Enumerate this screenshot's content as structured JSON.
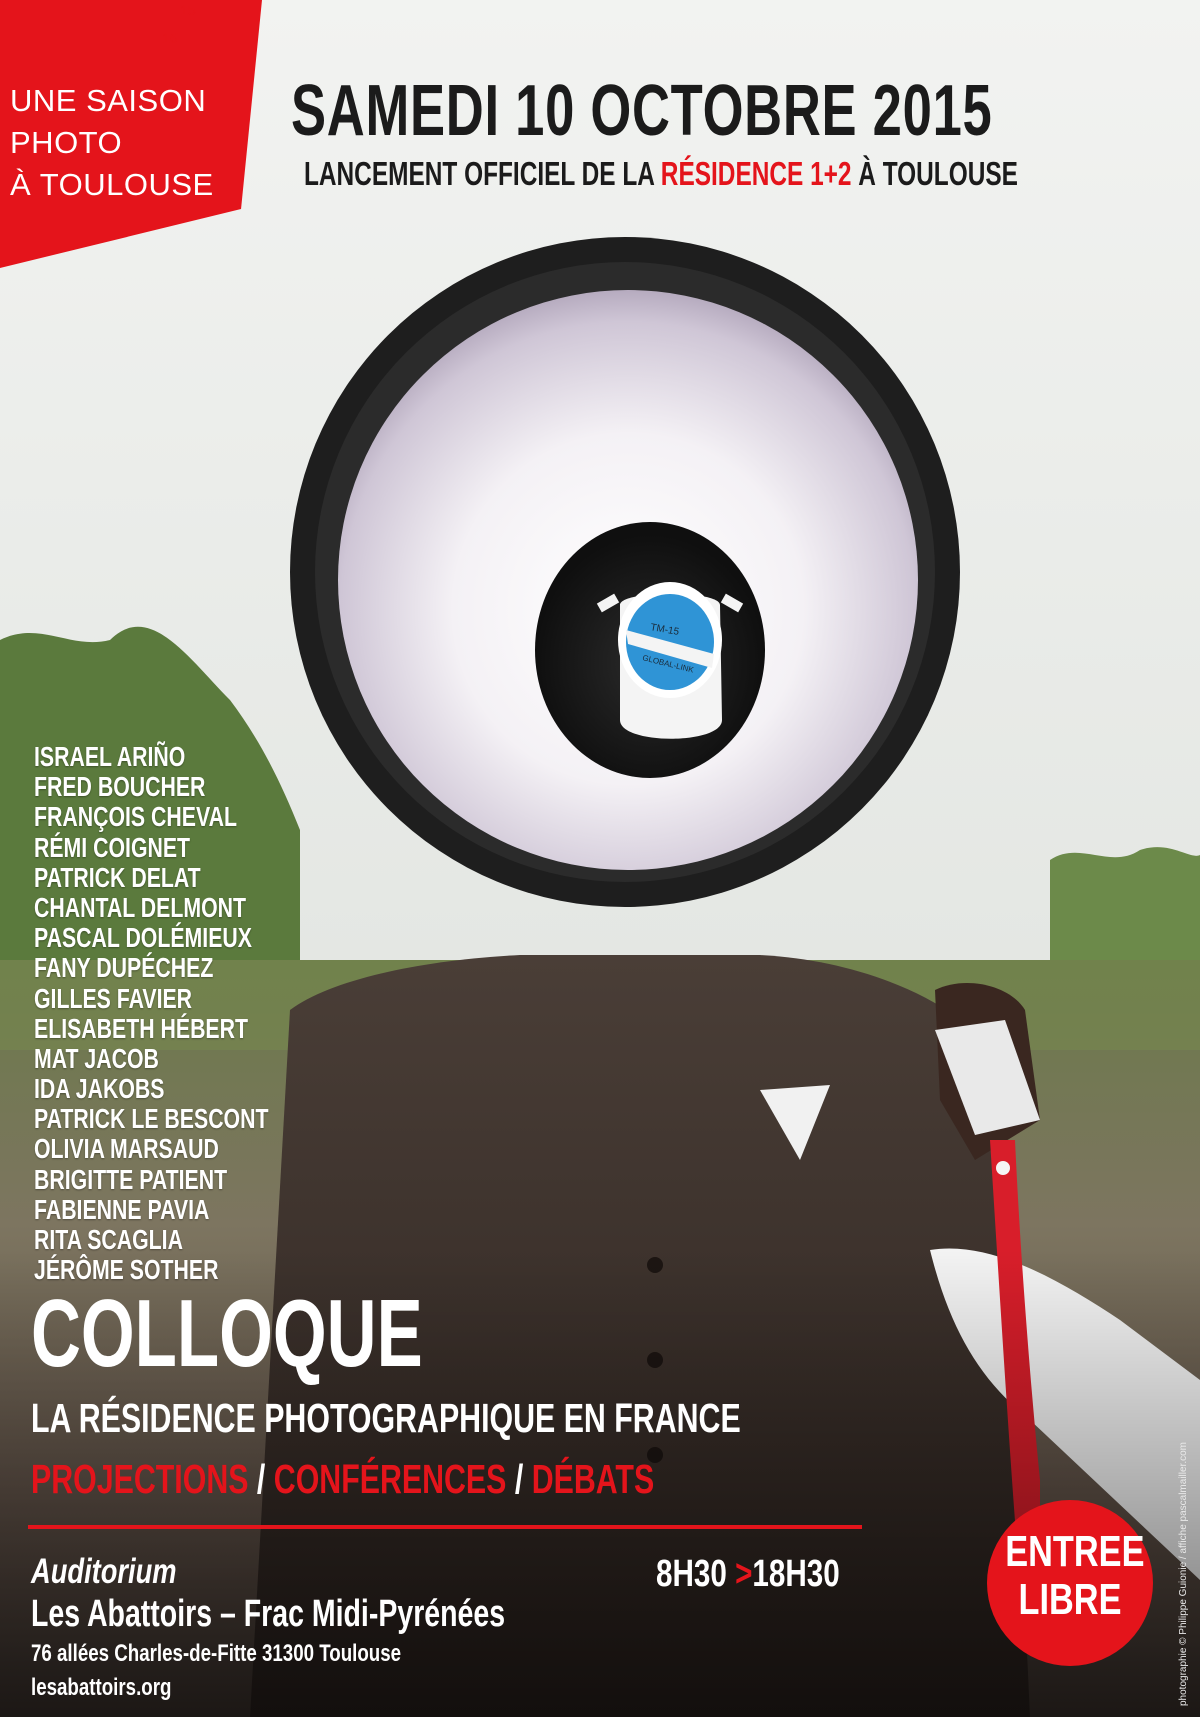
{
  "season": {
    "label_lines": [
      "UNE SAISON",
      "PHOTO",
      "À TOULOUSE"
    ],
    "mark_top": "15",
    "mark_bottom": "16"
  },
  "header": {
    "date": "SAMEDI 10 OCTOBRE 2015",
    "subtitle_before": "LANCEMENT OFFICIEL DE LA ",
    "subtitle_highlight": "RÉSIDENCE 1+2",
    "subtitle_after": " À TOULOUSE"
  },
  "artists": [
    "ISRAEL ARIÑO",
    "FRED BOUCHER",
    "FRANÇOIS CHEVAL",
    "RÉMI COIGNET",
    "PATRICK DELAT",
    "CHANTAL DELMONT",
    "PASCAL DOLÉMIEUX",
    "FANY DUPÉCHEZ",
    "GILLES FAVIER",
    "ELISABETH HÉBERT",
    "MAT JACOB",
    "IDA JAKOBS",
    "PATRICK LE BESCONT",
    "OLIVIA MARSAUD",
    "BRIGITTE PATIENT",
    "FABIENNE PAVIA",
    "RITA SCAGLIA",
    "JÉRÔME SOTHER"
  ],
  "event": {
    "kind": "COLLOQUE",
    "theme": "LA RÉSIDENCE PHOTOGRAPHIQUE EN FRANCE",
    "format_1": "PROJECTIONS",
    "format_2": "CONFÉRENCES",
    "format_3": "DÉBATS",
    "separator": " / "
  },
  "venue": {
    "room": "Auditorium",
    "name": "Les Abattoirs – Frac Midi-Pyrénées",
    "address": "76 allées Charles-de-Fitte 31300 Toulouse",
    "website": "lesabattoirs.org"
  },
  "schedule": {
    "start": "8H30",
    "arrow": ">",
    "end": "18H30"
  },
  "admission": {
    "line1": "ENTREE",
    "line2": "LIBRE"
  },
  "credit": "photographie © Philippe Guionie / affiche pascalmailler.com",
  "megaphone_label": {
    "model": "TM-15",
    "brand": "GLOBAL-LINK"
  },
  "colors": {
    "accent": "#e4141b",
    "ink": "#1b1b1b"
  }
}
